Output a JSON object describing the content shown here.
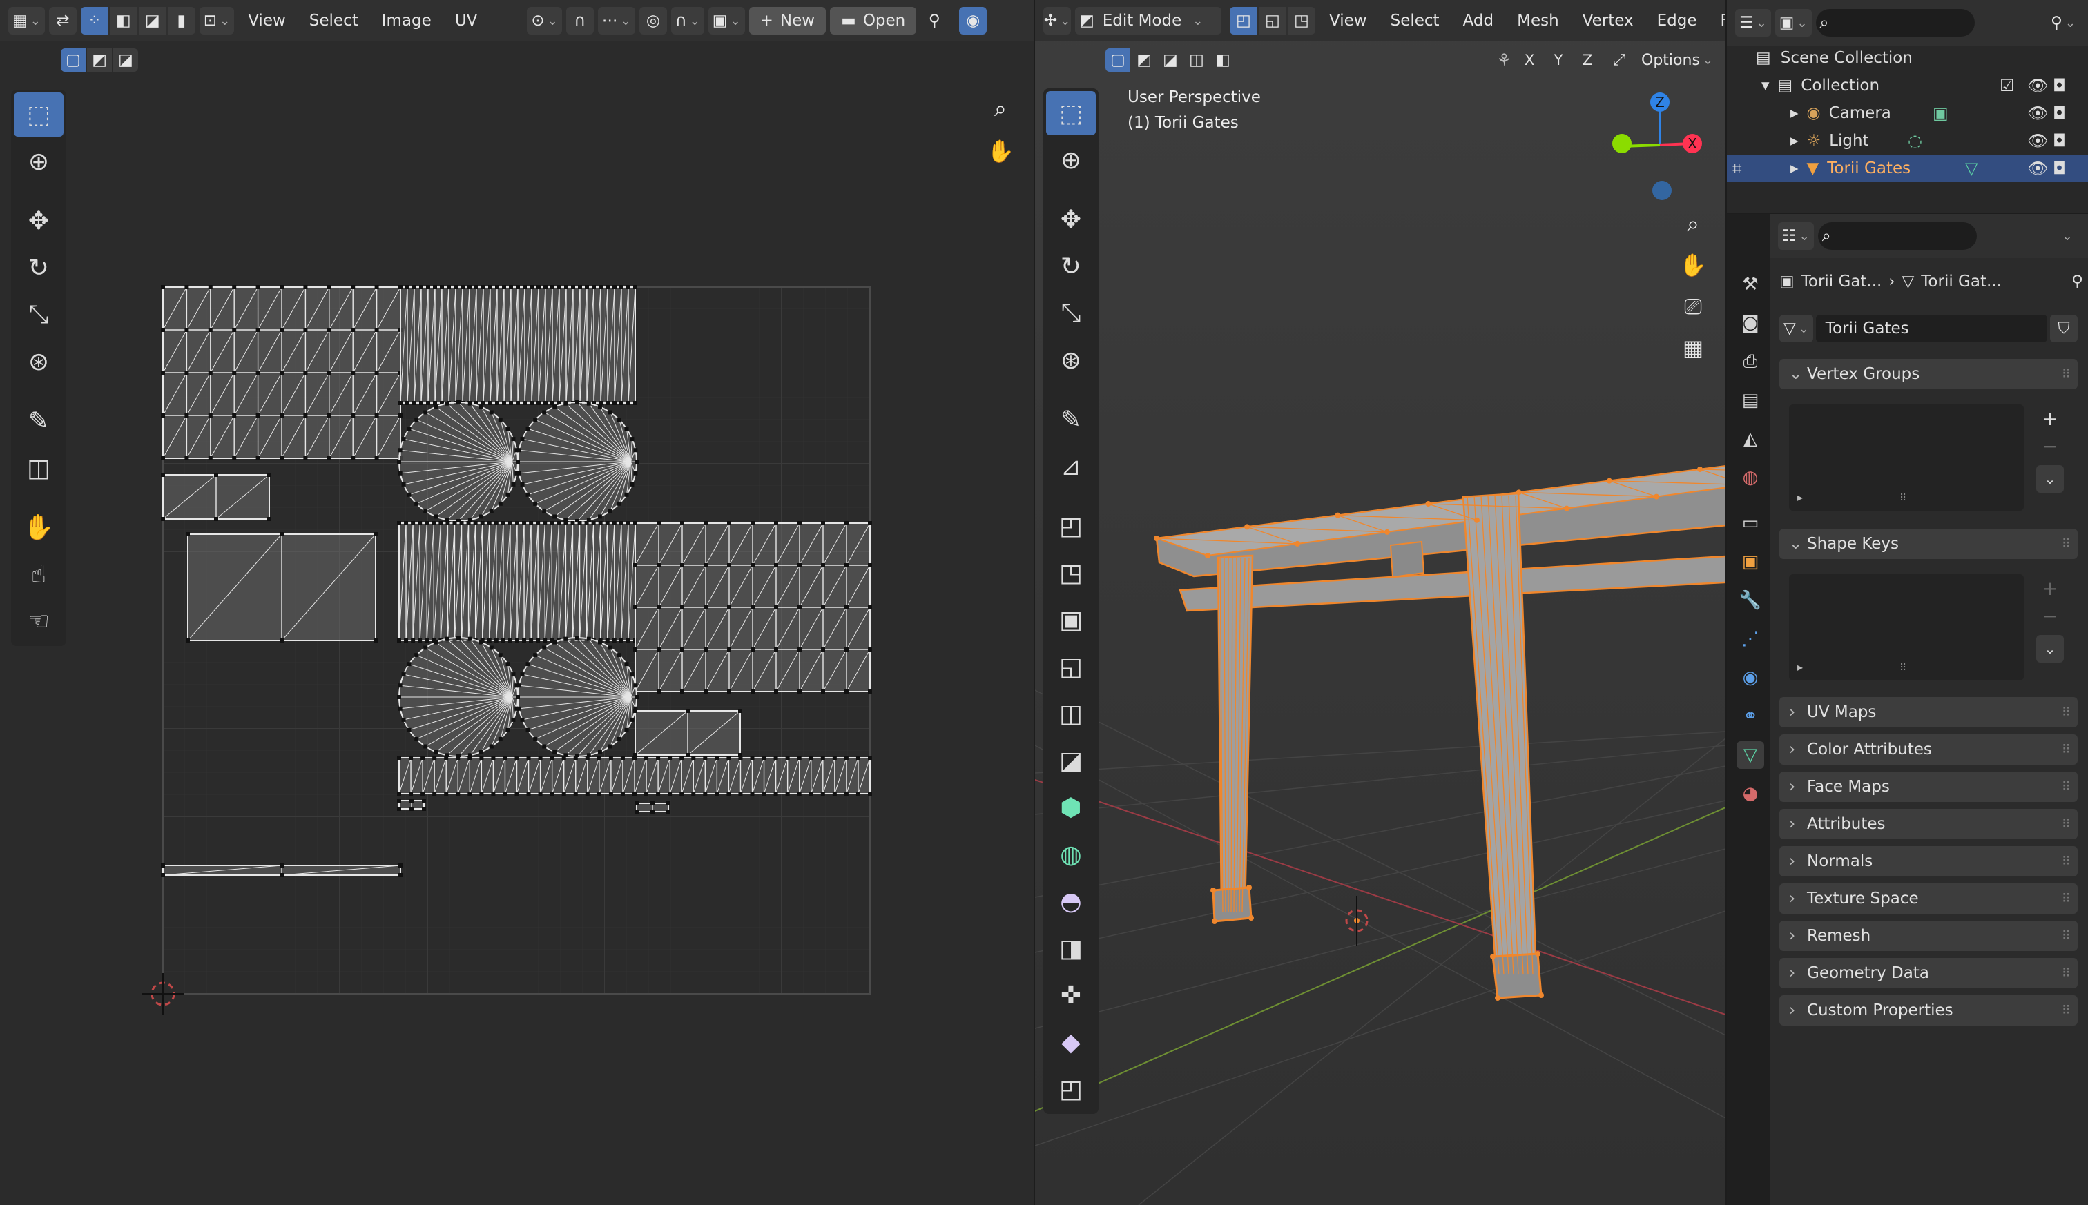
{
  "uv_editor": {
    "menus": [
      "View",
      "Select",
      "Image",
      "UV"
    ],
    "new_label": "New",
    "open_label": "Open"
  },
  "viewport": {
    "mode": "Edit Mode",
    "menus": [
      "View",
      "Select",
      "Add",
      "Mesh",
      "Vertex",
      "Edge",
      "Fa"
    ],
    "axes": [
      "X",
      "Y",
      "Z"
    ],
    "options_label": "Options",
    "overlay_line1": "User Perspective",
    "overlay_line2": "(1) Torii Gates",
    "gizmo": {
      "z": "Z",
      "x": "X"
    }
  },
  "outliner": {
    "scene_collection": "Scene Collection",
    "collection": "Collection",
    "items": [
      "Camera",
      "Light",
      "Torii Gates"
    ]
  },
  "properties": {
    "breadcrumb_object": "Torii Gat...",
    "breadcrumb_mesh": "Torii Gat...",
    "datablock_name": "Torii Gates",
    "sections": {
      "vertex_groups": "Vertex Groups",
      "shape_keys": "Shape Keys",
      "collapsed": [
        "UV Maps",
        "Color Attributes",
        "Face Maps",
        "Attributes",
        "Normals",
        "Texture Space",
        "Remesh",
        "Geometry Data",
        "Custom Properties"
      ]
    }
  },
  "colors": {
    "accent": "#4772b3",
    "selection_orange": "#f0872d",
    "mesh_data_green": "#5bd1a4",
    "outliner_selected": "#334d80",
    "x_axis_red": "#ff3352",
    "y_axis_green": "#8bdc00",
    "z_axis_blue": "#2f83e6"
  }
}
